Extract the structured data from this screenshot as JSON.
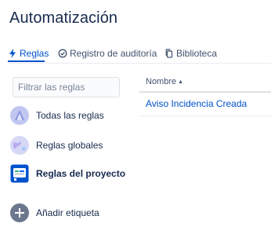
{
  "page": {
    "title": "Automatización"
  },
  "tabs": [
    {
      "label": "Reglas",
      "icon": "lightning-icon",
      "active": true
    },
    {
      "label": "Registro de auditoría",
      "icon": "check-circle-icon",
      "active": false
    },
    {
      "label": "Biblioteca",
      "icon": "copy-icon",
      "active": false
    }
  ],
  "sidebar": {
    "filter_placeholder": "Filtrar las reglas",
    "filter_value": "",
    "items": [
      {
        "label": "Todas las reglas",
        "icon": "all-rules-avatar-icon",
        "selected": false
      },
      {
        "label": "Reglas globales",
        "icon": "globe-avatar-icon",
        "selected": false
      },
      {
        "label": "Reglas del proyecto",
        "icon": "project-avatar-icon",
        "selected": true
      },
      {
        "label": "Añadir etiqueta",
        "icon": "add-circle-icon",
        "selected": false
      }
    ]
  },
  "table": {
    "columns": [
      {
        "label": "Nombre",
        "sort": "sort-arrow-icon"
      }
    ],
    "rows": [
      {
        "name": "Aviso Incidencia Creada"
      }
    ]
  },
  "colors": {
    "accent": "#0052cc",
    "text": "#172b4d",
    "muted": "#42526e",
    "border": "#dfe1e6"
  }
}
